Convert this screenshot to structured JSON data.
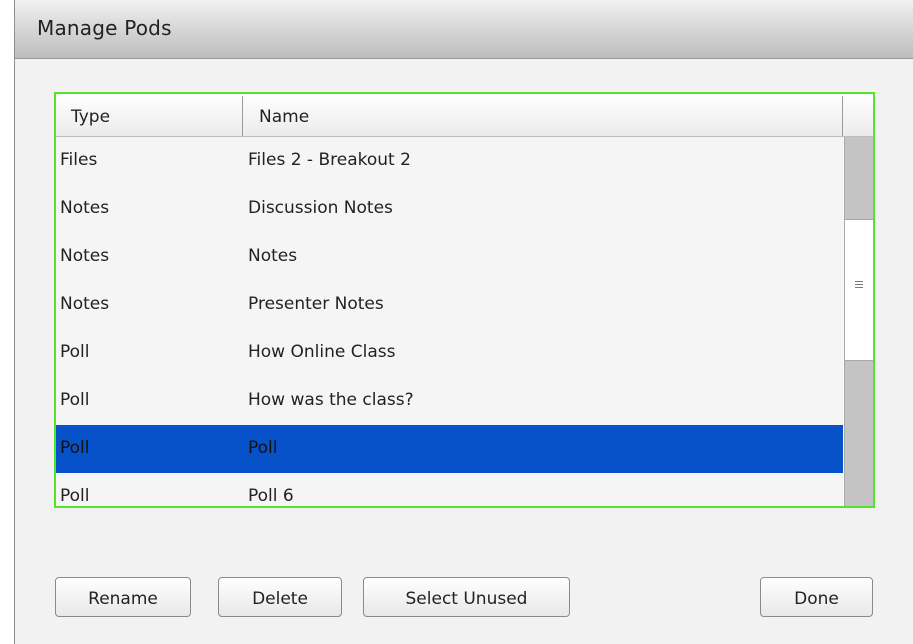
{
  "dialog": {
    "title": "Manage Pods"
  },
  "table": {
    "columns": [
      "Type",
      "Name"
    ],
    "rows": [
      {
        "type": "Files",
        "name": "Files 2 - Breakout 2"
      },
      {
        "type": "Notes",
        "name": "Discussion Notes"
      },
      {
        "type": "Notes",
        "name": "Notes"
      },
      {
        "type": "Notes",
        "name": "Presenter Notes"
      },
      {
        "type": "Poll",
        "name": "How Online Class"
      },
      {
        "type": "Poll",
        "name": "How was the class?"
      },
      {
        "type": "Poll",
        "name": "Poll"
      },
      {
        "type": "Poll",
        "name": "Poll 6"
      }
    ],
    "selected_row_index": 6
  },
  "buttons": {
    "rename": "Rename",
    "delete": "Delete",
    "select_unused": "Select Unused",
    "done": "Done"
  },
  "colors": {
    "selection": "#0752c9",
    "focus_border": "#52e52a"
  }
}
